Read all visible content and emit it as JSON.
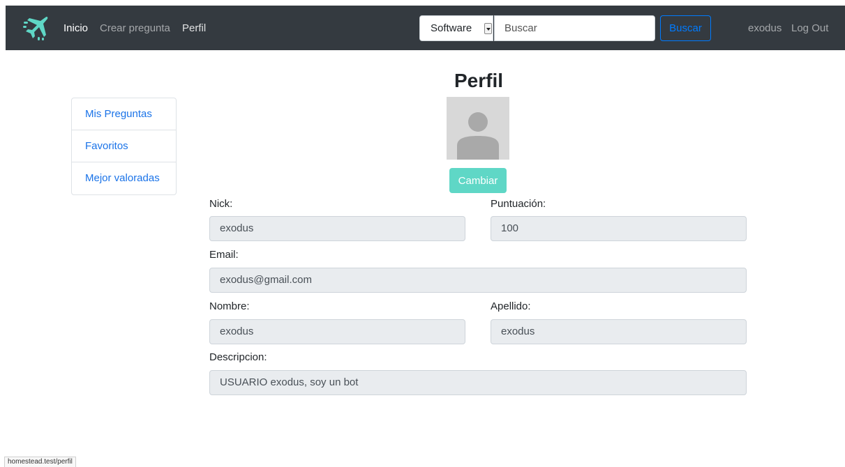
{
  "navbar": {
    "logo_icon": "airplane-logo-icon",
    "links": {
      "inicio": "Inicio",
      "crear_pregunta": "Crear pregunta",
      "perfil": "Perfil"
    },
    "category_select": {
      "selected": "Software"
    },
    "search": {
      "placeholder": "Buscar",
      "value": ""
    },
    "search_button": "Buscar",
    "username": "exodus",
    "logout": "Log Out",
    "colors": {
      "background": "#343a40",
      "accent": "#007bff"
    }
  },
  "sidebar": {
    "items": [
      {
        "label": "Mis Preguntas"
      },
      {
        "label": "Favoritos"
      },
      {
        "label": "Mejor valoradas"
      }
    ]
  },
  "profile": {
    "title": "Perfil",
    "avatar_icon": "user-avatar-icon",
    "change_button": "Cambiar",
    "fields": {
      "nick": {
        "label": "Nick:",
        "value": "exodus"
      },
      "puntuacion": {
        "label": "Puntuación:",
        "value": "100"
      },
      "email": {
        "label": "Email:",
        "value": "exodus@gmail.com"
      },
      "nombre": {
        "label": "Nombre:",
        "value": "exodus"
      },
      "apellido": {
        "label": "Apellido:",
        "value": "exodus"
      },
      "descripcion": {
        "label": "Descripcion:",
        "value": "USUARIO exodus, soy un bot"
      }
    },
    "colors": {
      "change_button": "#5fd7c6",
      "readonly_field": "#e9ecef"
    }
  },
  "status_bar": {
    "url": "homestead.test/perfil"
  }
}
